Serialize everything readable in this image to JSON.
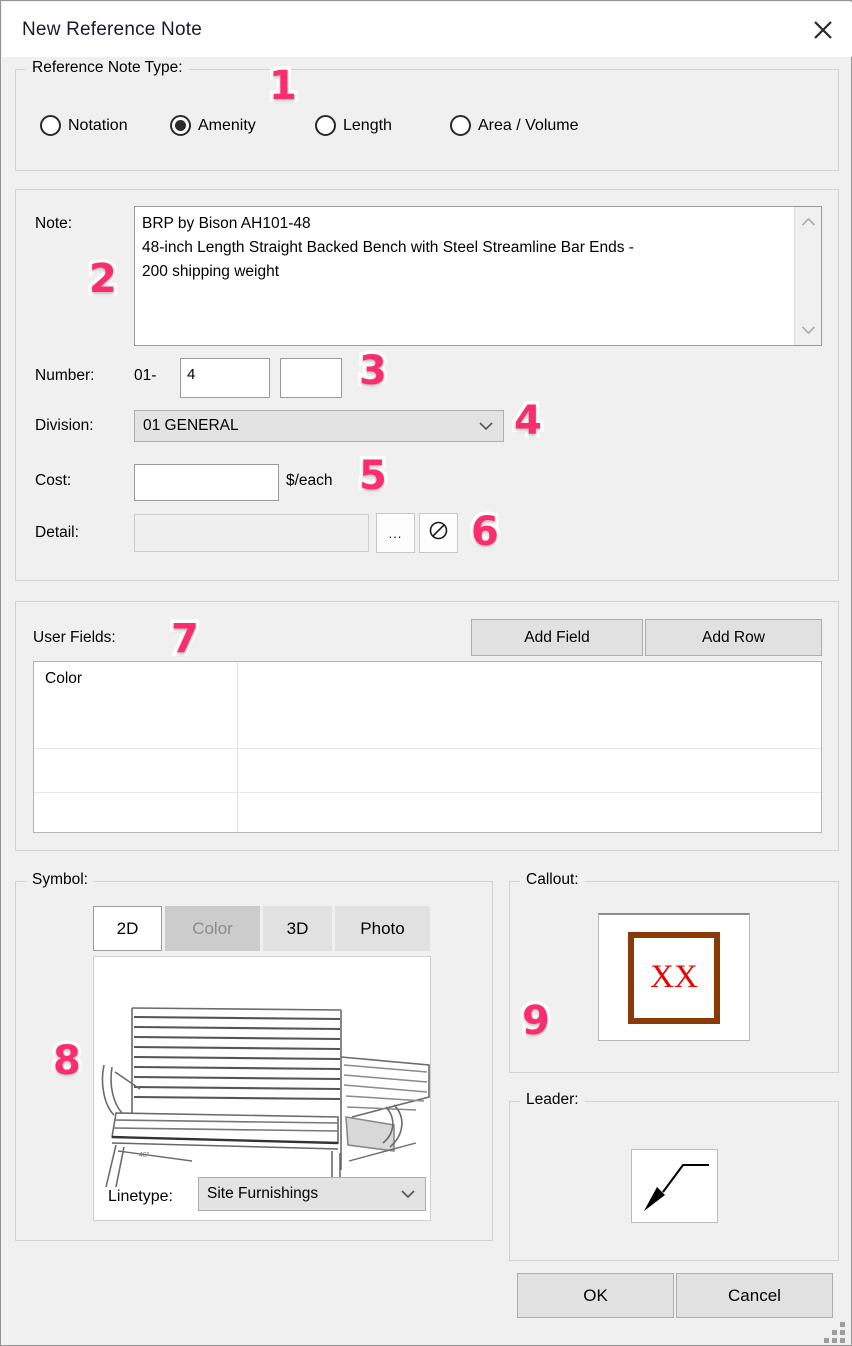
{
  "window": {
    "title": "New Reference Note",
    "close_icon": "close-icon"
  },
  "note_type": {
    "group_label": "Reference Note Type:",
    "options": [
      {
        "label": "Notation",
        "selected": false
      },
      {
        "label": "Amenity",
        "selected": true
      },
      {
        "label": "Length",
        "selected": false
      },
      {
        "label": "Area / Volume",
        "selected": false
      }
    ]
  },
  "note": {
    "label": "Note:",
    "value": "BRP by Bison AH101-48\n48-inch Length Straight Backed Bench with Steel Streamline Bar Ends -\n200 shipping weight",
    "scroll_up_icon": "chevron-up-icon",
    "scroll_down_icon": "chevron-down-icon"
  },
  "number": {
    "label": "Number:",
    "prefix": "01-",
    "value": "4",
    "suffix_value": ""
  },
  "division": {
    "label": "Division:",
    "value": "01  GENERAL",
    "arrow_icon": "chevron-down-icon"
  },
  "cost": {
    "label": "Cost:",
    "value": "",
    "unit": "$/each"
  },
  "detail": {
    "label": "Detail:",
    "value": "",
    "browse_label": "...",
    "clear_icon": "no-entry-icon"
  },
  "user_fields": {
    "label": "User Fields:",
    "add_field_label": "Add Field",
    "add_row_label": "Add Row",
    "rows": [
      [
        "Color",
        ""
      ],
      [
        "",
        ""
      ],
      [
        "",
        ""
      ]
    ]
  },
  "symbol": {
    "group_label": "Symbol:",
    "tabs": [
      {
        "label": "2D",
        "state": "active"
      },
      {
        "label": "Color",
        "state": "disabled"
      },
      {
        "label": "3D",
        "state": "normal"
      },
      {
        "label": "Photo",
        "state": "normal"
      }
    ],
    "image_alt": "park-bench-line-drawing",
    "linetype": {
      "label": "Linetype:",
      "value": "Site Furnishings",
      "arrow_icon": "chevron-down-icon"
    }
  },
  "callout": {
    "group_label": "Callout:",
    "text": "XX",
    "text_color": "#ee0000",
    "border_color": "#8a3a06"
  },
  "leader": {
    "group_label": "Leader:",
    "icon": "leader-arrow-icon"
  },
  "footer": {
    "ok_label": "OK",
    "cancel_label": "Cancel"
  },
  "badges": {
    "b1": "1",
    "b2": "2",
    "b3": "3",
    "b4": "4",
    "b5": "5",
    "b6": "6",
    "b7": "7",
    "b8": "8",
    "b9": "9",
    "color": "#fa2d6e"
  }
}
